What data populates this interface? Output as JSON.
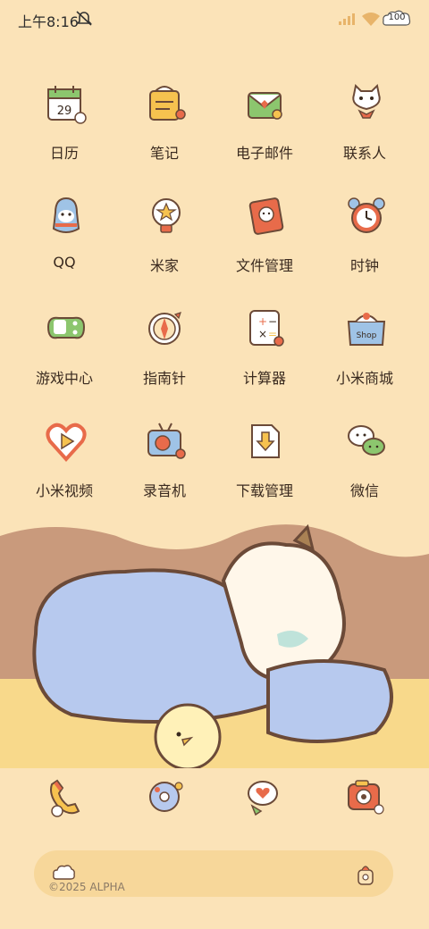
{
  "status_bar": {
    "time": "上午8:16",
    "battery": "100"
  },
  "apps": [
    {
      "label": "日历",
      "icon": "calendar-icon"
    },
    {
      "label": "笔记",
      "icon": "notes-icon"
    },
    {
      "label": "电子邮件",
      "icon": "email-icon"
    },
    {
      "label": "联系人",
      "icon": "contacts-icon"
    },
    {
      "label": "QQ",
      "icon": "qq-penguin-icon"
    },
    {
      "label": "米家",
      "icon": "mijia-icon"
    },
    {
      "label": "文件管理",
      "icon": "file-manager-icon"
    },
    {
      "label": "时钟",
      "icon": "clock-icon"
    },
    {
      "label": "游戏中心",
      "icon": "game-center-icon"
    },
    {
      "label": "指南针",
      "icon": "compass-icon"
    },
    {
      "label": "计算器",
      "icon": "calculator-icon"
    },
    {
      "label": "小米商城",
      "icon": "mi-store-icon"
    },
    {
      "label": "小米视频",
      "icon": "mi-video-icon"
    },
    {
      "label": "录音机",
      "icon": "recorder-icon"
    },
    {
      "label": "下载管理",
      "icon": "download-icon"
    },
    {
      "label": "微信",
      "icon": "wechat-icon"
    }
  ],
  "calendar_day": "29",
  "store_word": "Shop",
  "dock": [
    {
      "icon": "phone-icon"
    },
    {
      "icon": "browser-icon"
    },
    {
      "icon": "messages-icon"
    },
    {
      "icon": "camera-icon"
    }
  ],
  "search_bar": {
    "copyright": "©2025 ALPHA"
  },
  "colors": {
    "background": "#FBE3B8",
    "search_bar": "#F7D79A",
    "outline": "#6b4a38"
  }
}
